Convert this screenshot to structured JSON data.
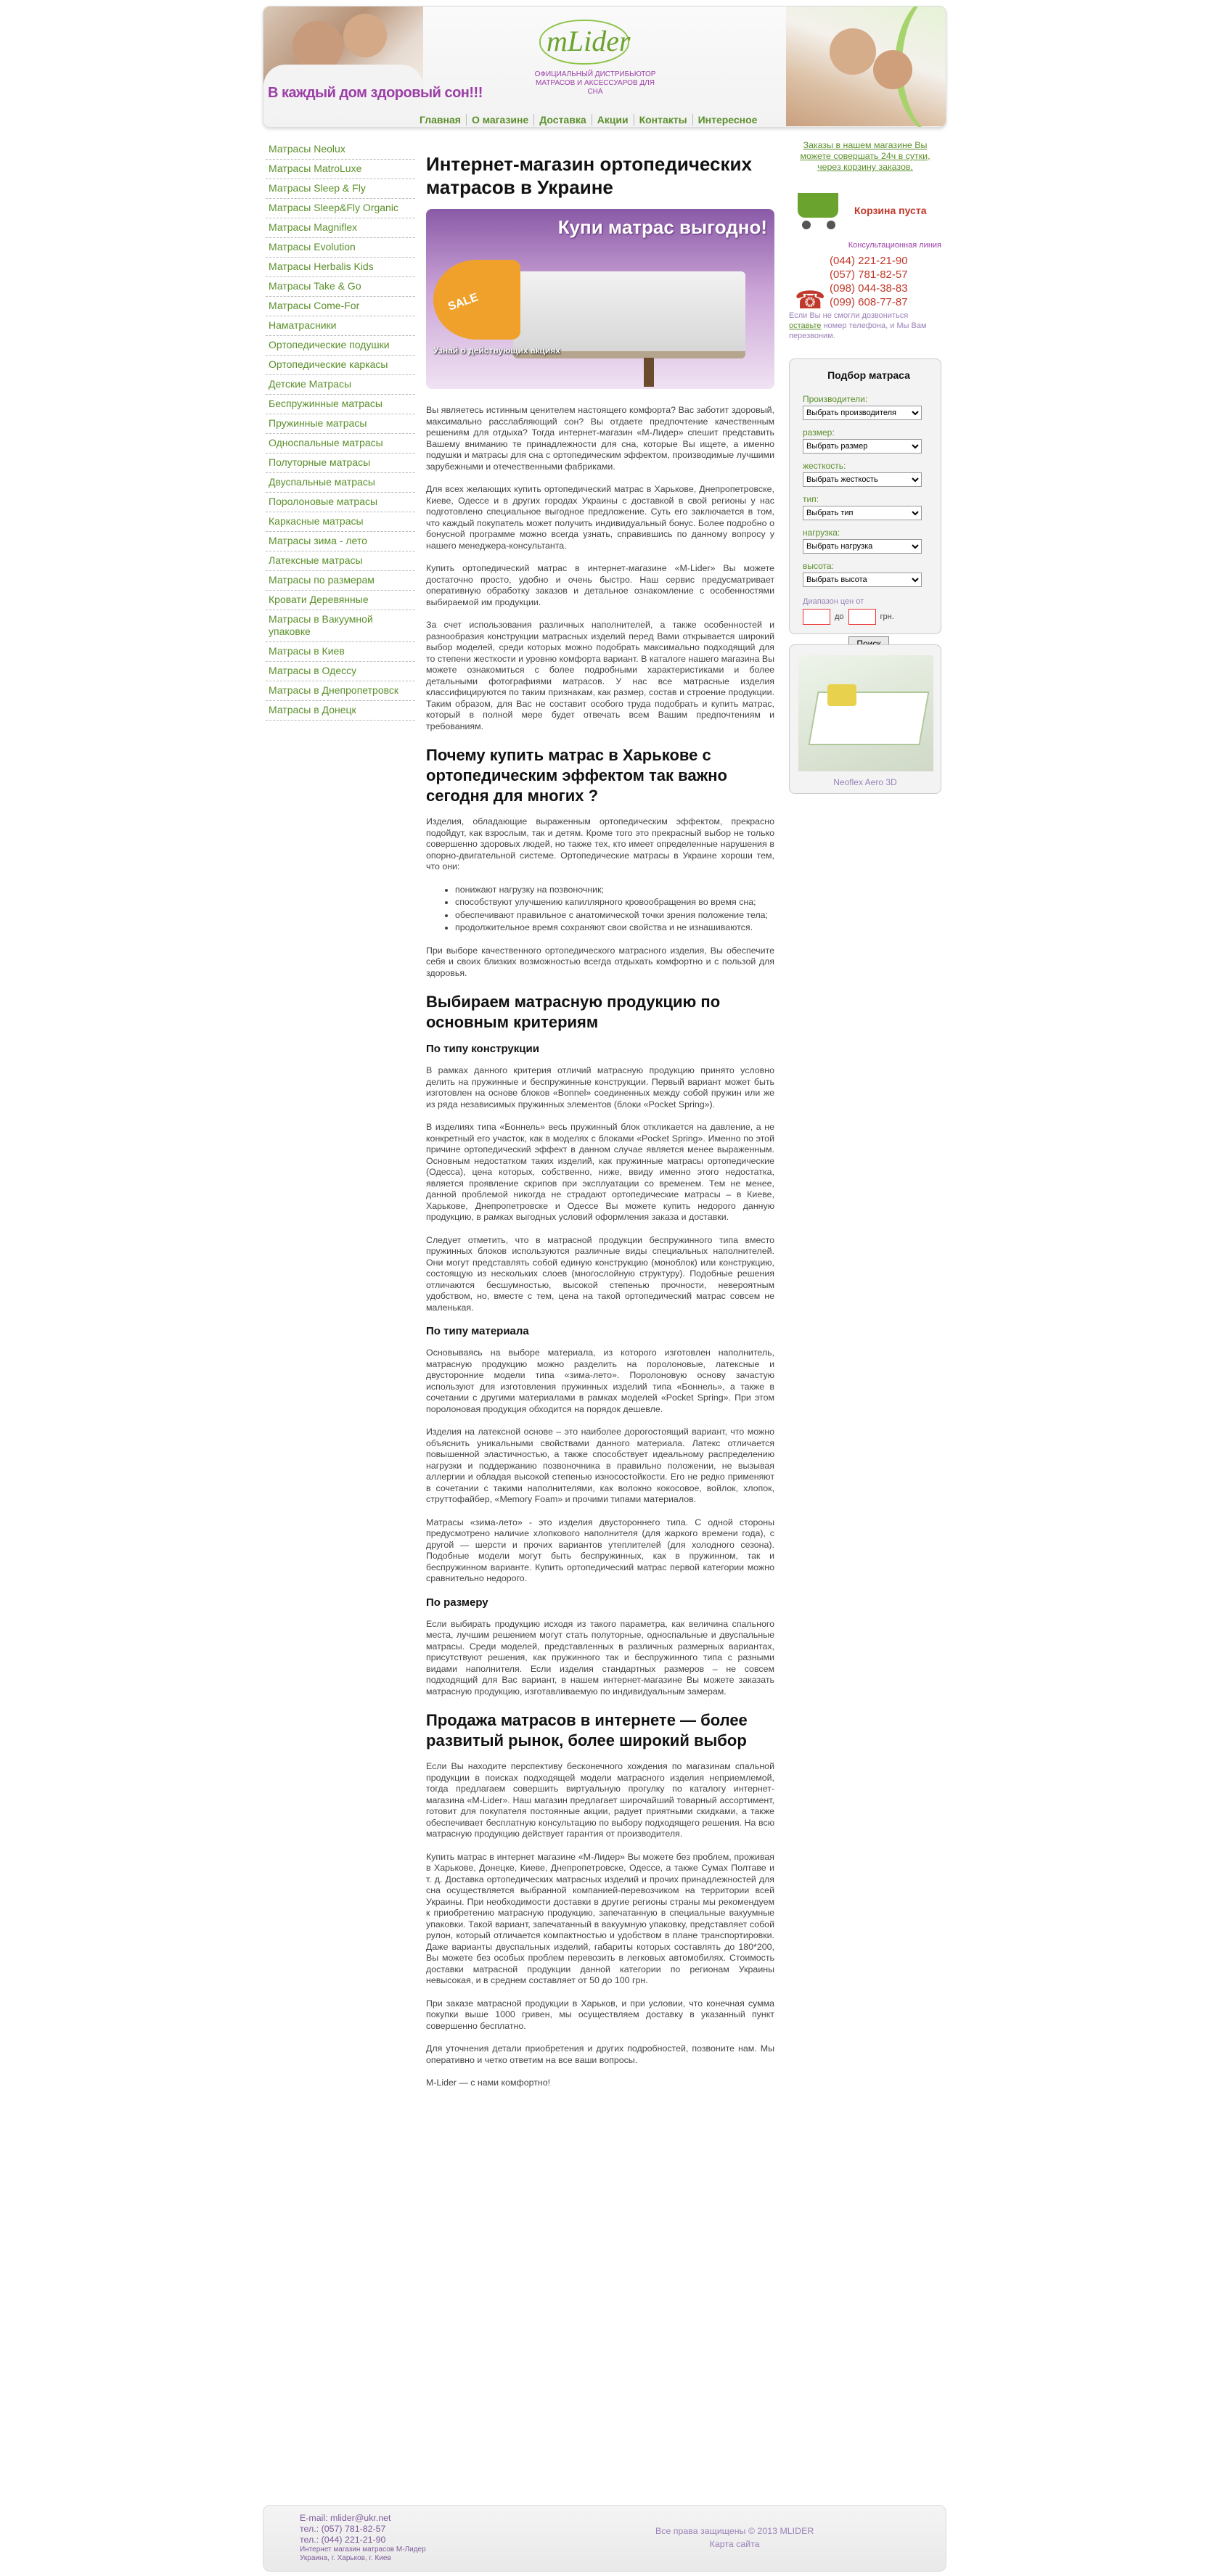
{
  "header": {
    "slogan": "В каждый дом здоровый сон!!!",
    "logo": "mLider",
    "subtitle": "ОФИЦИАЛЬНЫЙ ДИСТРИБЬЮТОР МАТРАСОВ И АКСЕССУАРОВ ДЛЯ СНА",
    "nav": [
      "Главная",
      "О магазине",
      "Доставка",
      "Акции",
      "Контакты",
      "Интересное"
    ]
  },
  "sidebar": {
    "items": [
      "Матрасы Neolux",
      "Матрасы MatroLuxe",
      "Матрасы Sleep & Fly",
      "Матрасы Sleep&Fly Organic",
      "Матрасы Magniflex",
      "Матрасы Evolution",
      "Матрасы Herbalis Kids",
      "Матрасы Take & Go",
      "Матрасы Come-For",
      "Наматрасники",
      "Ортопедические подушки",
      "Ортопедические каркасы",
      "Детские Матрасы",
      "Беспружинные матрасы",
      "Пружинные матрасы",
      "Односпальные матрасы",
      "Полуторные матрасы",
      "Двуспальные матрасы",
      "Поролоновые матрасы",
      "Каркасные матрасы",
      "Матрасы зима - лето",
      "Латексные матрасы",
      "Матрасы по размерам",
      "Кровати Деревянные",
      "Матрасы в Вакуумной упаковке",
      "Матрасы в Киев",
      "Матрасы в Одессу",
      "Матрасы в Днепропетровск",
      "Матрасы в Донецк"
    ]
  },
  "main": {
    "title": "Интернет-магазин ортопедических матрасов в Украине",
    "promo": {
      "title": "Купи матрас выгодно!",
      "sale": "SALE",
      "caption": "Узнай о действующих акциях"
    },
    "p1": "Вы являетесь истинным ценителем настоящего комфорта? Вас заботит здоровый, максимально расслабляющий сон? Вы отдаете предпочтение качественным решениям для отдыха? Тогда интернет-магазин «М-Лидер» спешит представить Вашему вниманию те принадлежности для сна, которые Вы ищете, а именно подушки и матрасы для сна с ортопедическим эффектом, производимые лучшими зарубежными и отечественными фабриками.",
    "p2": "Для всех желающих купить ортопедический матрас в Харькове, Днепропетровске, Киеве, Одессе и в других городах Украины с доставкой в свой регионы у нас подготовлено специальное выгодное предложение. Суть его заключается в том, что каждый покупатель может получить индивидуальный бонус. Более подробно о бонусной программе можно всегда узнать, справившись по данному вопросу у нашего менеджера-консультанта.",
    "p3": "Купить ортопедический матрас в интернет-магазине «М-Lider» Вы можете достаточно просто, удобно и очень быстро. Наш сервис предусматривает оперативную обработку заказов и детальное ознакомление с особенностями выбираемой им продукции.",
    "p4": "За счет использования различных наполнителей, а также особенностей и разнообразия конструкции матрасных изделий перед Вами открывается широкий выбор моделей, среди которых можно подобрать максимально подходящий для то степени жесткости и уровню комфорта вариант. В каталоге нашего магазина Вы можете ознакомиться с более подробными характеристиками и более детальными фотографиями матрасов. У нас все матрасные изделия классифицируются по таким признакам, как размер, состав и строение продукции. Таким образом, для Вас не составит особого труда подобрать и купить матрас, который в полной мере будет отвечать всем Вашим предпочтениям и требованиям.",
    "h2a": "Почему купить матрас в Харькове с ортопедическим эффектом так важно сегодня для многих ?",
    "p5": "Изделия, обладающие выраженным ортопедическим эффектом, прекрасно подойдут, как взрослым, так и детям. Кроме того это прекрасный выбор не только совершенно здоровых людей, но также тех, кто имеет определенные нарушения в опорно-двигательной системе. Ортопедические матрасы в Украине хороши тем, что они:",
    "bullets": [
      "понижают нагрузку на позвоночник;",
      "способствуют улучшению капиллярного кровообращения во время сна;",
      "обеспечивают правильное с анатомической точки зрения положение тела;",
      "продолжительное время сохраняют свои свойства и не изнашиваются."
    ],
    "p6": "При выборе качественного ортопедического матрасного изделия, Вы обеспечите себя и своих близких возможностью всегда отдыхать комфортно и с пользой для здоровья.",
    "h2b": "Выбираем матрасную продукцию по основным критериям",
    "h3a": "По типу конструкции",
    "p7": "В рамках данного критерия отличий матрасную продукцию принято условно делить на пружинные и беспружинные конструкции. Первый вариант может быть изготовлен на основе блоков «Bonnel» соединенных между собой пружин или же из ряда независимых пружинных элементов (блоки «Pocket Spring»).",
    "p8": "В изделиях типа «Боннель» весь пружинный блок откликается на давление, а не конкретный его участок, как в моделях с блоками «Pocket Spring». Именно по этой причине ортопедический эффект в данном случае является менее выраженным. Основным недостатком таких изделий, как пружинные матрасы ортопедические (Одесса), цена которых, собственно, ниже, ввиду именно этого недостатка, является проявление скрипов при эксплуатации со временем. Тем не менее, данной проблемой никогда не страдают ортопедические матрасы – в Киеве, Харькове, Днепропетровске и Одессе Вы можете купить недорого данную продукцию, в рамках выгодных условий оформления заказа и доставки.",
    "p9": "Следует отметить, что в матрасной продукции беспружинного типа вместо пружинных блоков используются различные виды специальных наполнителей. Они могут представлять собой единую конструкцию (моноблок) или конструкцию, состоящую из нескольких слоев (многослойную структуру). Подобные решения отличаются бесшумностью, высокой степенью прочности, невероятным удобством, но, вместе с тем, цена на такой ортопедический матрас совсем не маленькая.",
    "h3b": "По типу материала",
    "p10": "Основываясь на выборе материала, из которого изготовлен наполнитель, матрасную продукцию можно разделить на поролоновые, латексные и двусторонние модели типа «зима-лето». Поролоновую основу зачастую используют для изготовления пружинных изделий типа «Боннель», а также в сочетании с другими материалами в рамках моделей «Pocket Spring». При этом поролоновая продукция обходится на порядок дешевле.",
    "p11": "Изделия на латексной основе – это наиболее дорогостоящий вариант, что можно объяснить уникальными свойствами данного материала. Латекс отличается повышенной эластичностью, а также способствует идеальному распределению нагрузки и поддержанию позвоночника в правильно положении, не вызывая аллергии и обладая высокой степенью износостойкости. Его не редко применяют в сочетании с такими наполнителями, как волокно кокосовое, войлок, хлопок, струттофайбер, «Memory Foam» и прочими типами материалов.",
    "p12": "Матрасы «зима-лето» - это изделия двустороннего типа. С одной стороны предусмотрено наличие хлопкового наполнителя (для жаркого времени года), с другой — шерсти и прочих вариантов утеплителей (для холодного сезона). Подобные модели могут быть беспружинных, как в пружинном, так и беспружинном варианте. Купить ортопедический матрас первой категории можно сравнительно недорого.",
    "h3c": "По размеру",
    "p13": "Если выбирать продукцию исходя из такого параметра, как величина спального места, лучшим решением могут стать полуторные, односпальные и двуспальные матрасы. Среди моделей, представленных в различных размерных вариантах, присутствуют решения, как пружинного так и беспружинного типа с разными видами наполнителя. Если изделия стандартных размеров – не совсем подходящий для Вас вариант, в нашем интернет-магазине Вы можете заказать матрасную продукцию, изготавливаемую по индивидуальным замерам.",
    "h2c": "Продажа матрасов в интернете — более развитый рынок, более широкий выбор",
    "p14": "Если Вы находите перспективу бесконечного хождения по магазинам спальной продукции в поисках подходящей модели матрасного изделия неприемлемой, тогда предлагаем совершить виртуальную прогулку по каталогу интернет-магазина «М-Lider». Наш магазин предлагает широчайший товарный ассортимент, готовит для покупателя постоянные акции, радует приятными скидками, а также обеспечивает бесплатную консультацию по выбору подходящего решения. На всю матрасную продукцию действует гарантия от производителя.",
    "p15": "Купить матрас в интернет магазине «М-Лидер» Вы можете без проблем, проживая в Харькове, Донецке, Киеве, Днепропетровске, Одессе, а также Сумах Полтаве и т. д. Доставка ортопедических матрасных изделий и прочих принадлежностей для сна осуществляется выбранной компанией-перевозчиком на территории всей Украины. При необходимости доставки в другие регионы страны мы рекомендуем к приобретению матрасную продукцию, запечатанную в специальные вакуумные упаковки. Такой вариант, запечатанный в вакуумную упаковку, представляет собой рулон, который отличается компактностью и удобством в плане транспортировки. Даже варианты двуспальных изделий, габариты которых составлять до 180*200, Вы можете без особых проблем перевозить в легковых автомобилях. Стоимость доставки матрасной продукции данной категории по регионам Украины невысокая, и в среднем составляет от 50 до 100 грн.",
    "p16": "При заказе матрасной продукции в Харьков, и при условии, что конечная сумма покупки выше 1000 гривен, мы осуществляем доставку в указанный пункт совершенно бесплатно.",
    "p17": "Для уточнения детали приобретения и других подробностей, позвоните нам. Мы оперативно и четко ответим на все ваши вопросы.",
    "p18": "M-Lider — с нами комфортно!"
  },
  "right": {
    "notice": "Заказы в нашем магазине Вы можете совершать 24ч в сутки, через корзину заказов.",
    "cart_label": "Корзина пуста",
    "consult_label": "Консультационная линия",
    "phones": [
      "(044) 221-21-90",
      "(057) 781-82-57",
      "(098) 044-38-83",
      "(099) 608-77-87"
    ],
    "callback_pre": "Если Вы не смогли дозвониться",
    "callback_link": "оставьте",
    "callback_post": "номер телефона, и Мы Вам перезвоним.",
    "picker": {
      "title": "Подбор матраса",
      "fields": [
        {
          "label": "Производители:",
          "value": "Выбрать производителя"
        },
        {
          "label": "размер:",
          "value": "Выбрать размер"
        },
        {
          "label": "жесткость:",
          "value": "Выбрать жесткость"
        },
        {
          "label": "тип:",
          "value": "Выбрать тип"
        },
        {
          "label": "нагрузка:",
          "value": "Выбрать нагрузка"
        },
        {
          "label": "высота:",
          "value": "Выбрать высота"
        }
      ],
      "range_label": "Диапазон цен от",
      "to": "до",
      "currency": "грн.",
      "button": "Поиск"
    },
    "product_caption": "Neoflex Aero 3D"
  },
  "footer": {
    "email": "E-mail: mlider@ukr.net",
    "tel1": "тел.: (057) 781-82-57",
    "tel2": "тел.: (044) 221-21-90",
    "shop": "Интернет магазин матрасов М-Лидер",
    "address": "Украина, г. Харьков, г. Киев",
    "copyright": "Все права защищены © 2013 MLIDER",
    "sitemap": "Карта сайта"
  }
}
